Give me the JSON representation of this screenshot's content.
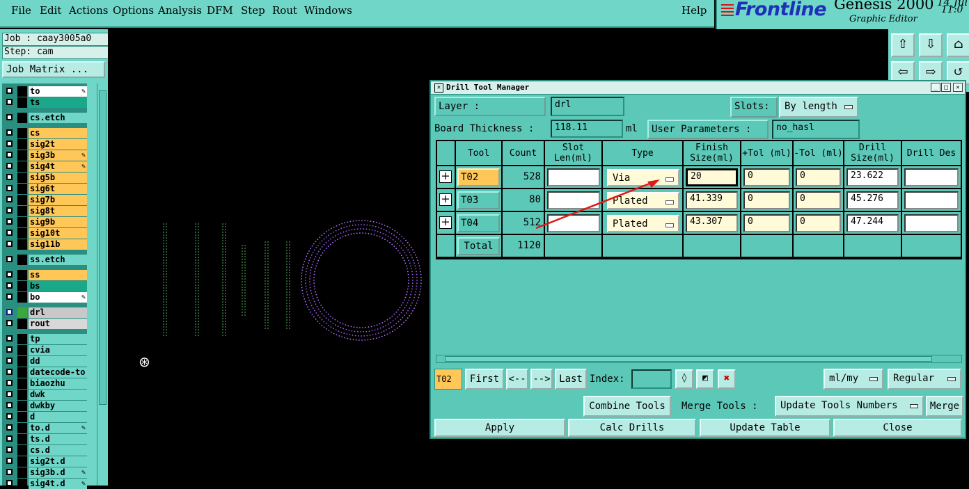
{
  "menu": {
    "items": [
      "File",
      "Edit",
      "Actions",
      "Options",
      "Analysis",
      "DFM",
      "Step",
      "Rout",
      "Windows"
    ],
    "help": "Help"
  },
  "brand": {
    "logo": "Frontline",
    "product": "Genesis 2000",
    "subtitle": "Graphic Editor",
    "date": "14 Jul",
    "time": "11:0"
  },
  "job": {
    "job_label": "Job : caay3005a0",
    "step_label": "Step: cam",
    "matrix_button": "Job Matrix ..."
  },
  "layers": [
    {
      "name": "to",
      "color": "#ffffff",
      "pen": true
    },
    {
      "name": "ts",
      "color": "#1aa88a",
      "pen": false
    },
    {
      "name": "cs.etch",
      "color": "#6fd6c8",
      "pen": false
    },
    {
      "name": "cs",
      "color": "#ffc658",
      "pen": false
    },
    {
      "name": "sig2t",
      "color": "#ffc658",
      "pen": false
    },
    {
      "name": "sig3b",
      "color": "#ffc658",
      "pen": true
    },
    {
      "name": "sig4t",
      "color": "#ffc658",
      "pen": true
    },
    {
      "name": "sig5b",
      "color": "#ffc658",
      "pen": false
    },
    {
      "name": "sig6t",
      "color": "#ffc658",
      "pen": false
    },
    {
      "name": "sig7b",
      "color": "#ffc658",
      "pen": false
    },
    {
      "name": "sig8t",
      "color": "#ffc658",
      "pen": false
    },
    {
      "name": "sig9b",
      "color": "#ffc658",
      "pen": false
    },
    {
      "name": "sig10t",
      "color": "#ffc658",
      "pen": false
    },
    {
      "name": "sig11b",
      "color": "#ffc658",
      "pen": false
    },
    {
      "name": "ss.etch",
      "color": "#6fd6c8",
      "pen": false
    },
    {
      "name": "ss",
      "color": "#ffc658",
      "pen": false
    },
    {
      "name": "bs",
      "color": "#1aa88a",
      "pen": false
    },
    {
      "name": "bo",
      "color": "#ffffff",
      "pen": true
    },
    {
      "name": "drl",
      "color": "#c8c8c8",
      "pen": false,
      "active": true
    },
    {
      "name": "rout",
      "color": "#d8d8d8",
      "pen": false
    },
    {
      "name": "tp",
      "color": "#6fd6c8",
      "pen": false
    },
    {
      "name": "cvia",
      "color": "#6fd6c8",
      "pen": false
    },
    {
      "name": "dd",
      "color": "#6fd6c8",
      "pen": false
    },
    {
      "name": "datecode-to",
      "color": "#6fd6c8",
      "pen": false
    },
    {
      "name": "biaozhu",
      "color": "#6fd6c8",
      "pen": false
    },
    {
      "name": "dwk",
      "color": "#6fd6c8",
      "pen": false
    },
    {
      "name": "dwkby",
      "color": "#6fd6c8",
      "pen": false
    },
    {
      "name": "d",
      "color": "#6fd6c8",
      "pen": false
    },
    {
      "name": "to.d",
      "color": "#6fd6c8",
      "pen": true
    },
    {
      "name": "ts.d",
      "color": "#6fd6c8",
      "pen": false
    },
    {
      "name": "cs.d",
      "color": "#6fd6c8",
      "pen": false
    },
    {
      "name": "sig2t.d",
      "color": "#6fd6c8",
      "pen": false
    },
    {
      "name": "sig3b.d",
      "color": "#6fd6c8",
      "pen": true
    },
    {
      "name": "sig4t.d",
      "color": "#6fd6c8",
      "pen": true
    }
  ],
  "dialog": {
    "title": "Drill Tool Manager",
    "layer_label": "Layer        :",
    "layer_value": "drl",
    "slots_label": "Slots:",
    "slots_value": "By length",
    "thickness_label": "Board Thickness :",
    "thickness_value": "118.11",
    "thickness_unit": "ml",
    "user_params_label": "User Parameters :",
    "user_params_value": "no_hasl",
    "columns": [
      "Tool",
      "Count",
      "Slot Len(ml)",
      "Type",
      "Finish Size(ml)",
      "+Tol (ml)",
      "-Tol (ml)",
      "Drill Size(ml)",
      "Drill Des"
    ],
    "rows": [
      {
        "tool": "T02",
        "count": "528",
        "slot_len": "",
        "type": "Via",
        "finish": "20",
        "ptol": "0",
        "mtol": "0",
        "drill": "23.622",
        "des": ""
      },
      {
        "tool": "T03",
        "count": "80",
        "slot_len": "",
        "type": "Plated",
        "finish": "41.339",
        "ptol": "0",
        "mtol": "0",
        "drill": "45.276",
        "des": ""
      },
      {
        "tool": "T04",
        "count": "512",
        "slot_len": "",
        "type": "Plated",
        "finish": "43.307",
        "ptol": "0",
        "mtol": "0",
        "drill": "47.244",
        "des": ""
      }
    ],
    "total_label": "Total",
    "total_count": "1120",
    "current_tool": "T02",
    "nav": {
      "first": "First",
      "prev": "<--",
      "next": "-->",
      "last": "Last",
      "index_label": "Index:"
    },
    "units_value": "ml/my",
    "mode_value": "Regular",
    "combine_label": "Combine Tools",
    "merge_tools_label": "Merge Tools :",
    "update_numbers_value": "Update Tools Numbers",
    "merge_label": "Merge",
    "apply_label": "Apply",
    "calc_label": "Calc Drills",
    "update_table_label": "Update Table",
    "close_label": "Close"
  }
}
